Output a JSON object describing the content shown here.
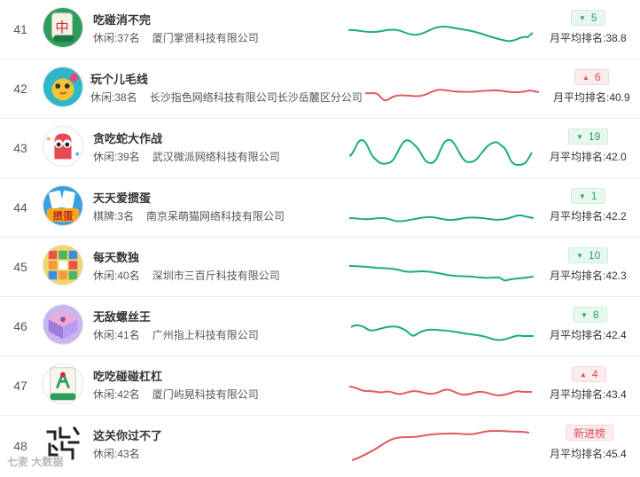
{
  "rows": [
    {
      "rank": "41",
      "name": "吃碰消不完",
      "category": "休闲:37名",
      "company": "厦门掌贤科技有限公司",
      "trend": "down",
      "change": "5",
      "avg": "月平均排名:38.8",
      "icon": "mahjong-zhong-icon"
    },
    {
      "rank": "42",
      "name": "玩个儿毛线",
      "category": "休闲:38名",
      "company": "长沙指色网络科技有限公司长沙岳麓区分公司",
      "trend": "up",
      "change": "6",
      "avg": "月平均排名:40.9",
      "icon": "yarn-duck-icon"
    },
    {
      "rank": "43",
      "name": "贪吃蛇大作战",
      "category": "休闲:39名",
      "company": "武汉微派网络科技有限公司",
      "trend": "down",
      "change": "19",
      "avg": "月平均排名:42.0",
      "icon": "snake-face-icon"
    },
    {
      "rank": "44",
      "name": "天天爱掼蛋",
      "category": "棋牌:3名",
      "company": "南京呆萌猫网络科技有限公司",
      "trend": "down",
      "change": "1",
      "avg": "月平均排名:42.2",
      "icon": "guandan-cards-icon"
    },
    {
      "rank": "45",
      "name": "每天数独",
      "category": "休闲:40名",
      "company": "深圳市三百斤科技有限公司",
      "trend": "down",
      "change": "10",
      "avg": "月平均排名:42.3",
      "icon": "sudoku-grid-icon"
    },
    {
      "rank": "46",
      "name": "无敌螺丝王",
      "category": "休闲:41名",
      "company": "广州指上科技有限公司",
      "trend": "down",
      "change": "8",
      "avg": "月平均排名:42.4",
      "icon": "screw-box-icon"
    },
    {
      "rank": "47",
      "name": "吃吃碰碰杠杠",
      "category": "休闲:42名",
      "company": "厦门屿晃科技有限公司",
      "trend": "up",
      "change": "4",
      "avg": "月平均排名:43.4",
      "icon": "mahjong-bamboo-icon"
    },
    {
      "rank": "48",
      "name": "这关你过不了",
      "category": "休闲:43名",
      "company": "",
      "trend": "new",
      "change": "新进榜",
      "avg": "月平均排名:45.4",
      "icon": "maze-glyph-icon"
    }
  ],
  "watermark": "七麦 大数据",
  "colors": {
    "down_line": "#1aaa88",
    "up_line": "#e05a60"
  }
}
